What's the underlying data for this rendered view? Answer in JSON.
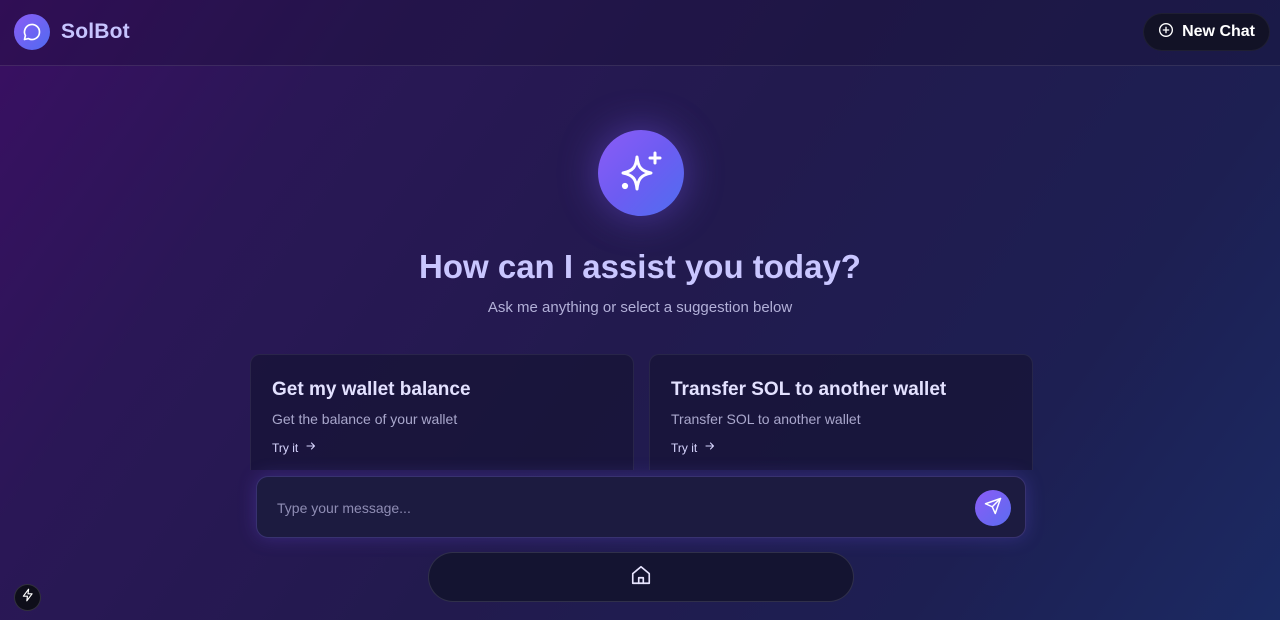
{
  "header": {
    "brand_name": "SolBot",
    "brand_icon": "chat-bubble-icon",
    "new_chat_label": "New Chat",
    "new_chat_icon": "plus-circle-icon"
  },
  "hero": {
    "icon": "sparkles-icon",
    "title": "How can I assist you today?",
    "subtitle": "Ask me anything or select a suggestion below"
  },
  "suggestions": [
    {
      "title": "Get my wallet balance",
      "description": "Get the balance of your wallet",
      "action_label": "Try it",
      "action_icon": "arrow-right-icon"
    },
    {
      "title": "Transfer SOL to another wallet",
      "description": "Transfer SOL to another wallet",
      "action_label": "Try it",
      "action_icon": "arrow-right-icon"
    }
  ],
  "composer": {
    "placeholder": "Type your message...",
    "value": "",
    "send_icon": "send-icon"
  },
  "bottom_nav": {
    "home_icon": "home-icon"
  },
  "dev_indicator": {
    "icon": "bolt-icon"
  },
  "colors": {
    "accent_start": "#8b5cf6",
    "accent_end": "#4f6ef0",
    "title": "#c9c6ff",
    "background": "#221a4e"
  }
}
